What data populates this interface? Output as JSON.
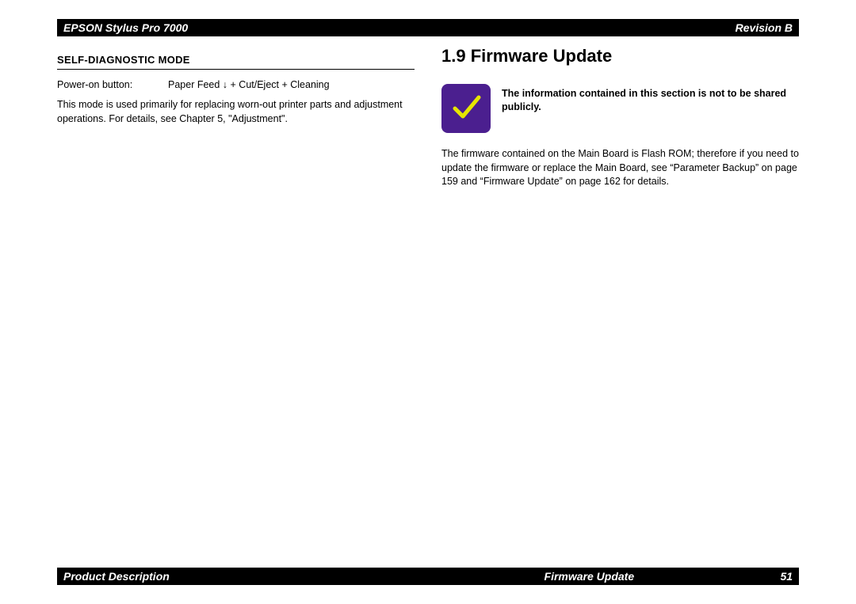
{
  "header": {
    "left": "EPSON Stylus Pro 7000",
    "right": "Revision B"
  },
  "footer": {
    "left": "Product Description",
    "center": "Firmware Update",
    "page": "51"
  },
  "left_col": {
    "section_title": "SELF-DIAGNOSTIC MODE",
    "kv_label": "Power-on button:",
    "kv_value": "Paper Feed ↓ + Cut/Eject + Cleaning",
    "body": "This mode is used primarily for replacing worn-out printer parts and adjustment operations. For details, see Chapter 5, \"Adjustment\"."
  },
  "right_col": {
    "heading": "1.9  Firmware Update",
    "confidential": "The information contained in this section is not to be shared publicly.",
    "body": "The firmware contained on the Main Board is Flash ROM; therefore if you need to update the firmware or replace the Main Board, see “Parameter Backup” on page 159 and “Firmware Update” on page 162 for details."
  }
}
